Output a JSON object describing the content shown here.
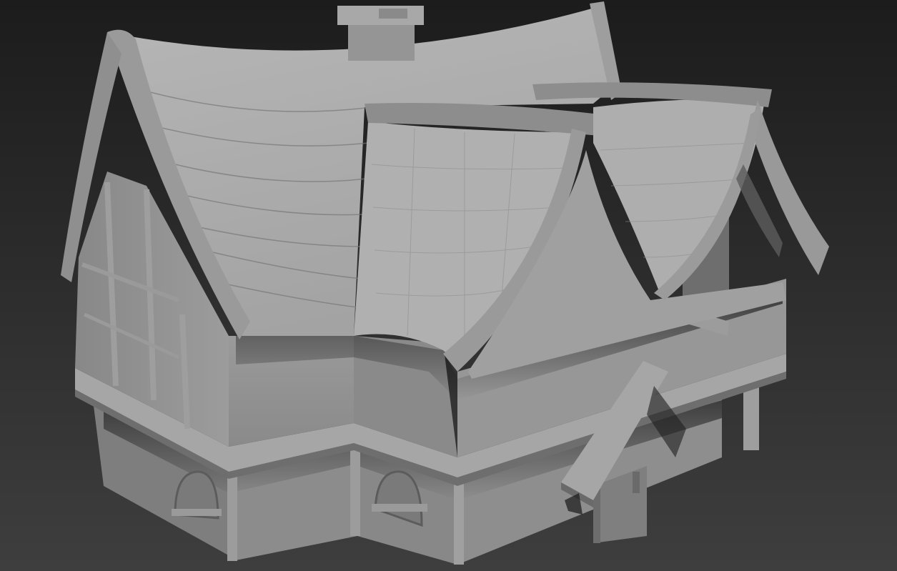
{
  "viewport": {
    "background_top": "#1c1c1c",
    "background_bottom": "#3e3e3e",
    "model_color": "#a9a9a9",
    "model_shadow": "#5a5a5a",
    "model_highlight": "#c2c2c2",
    "ao_color": "#101010"
  }
}
